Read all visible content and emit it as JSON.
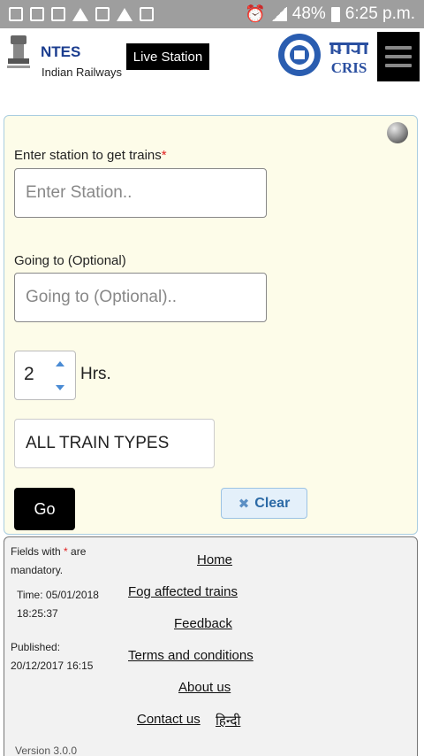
{
  "status_bar": {
    "battery": "48%",
    "time": "6:25 p.m."
  },
  "header": {
    "brand_title": "NTES",
    "brand_subtitle": "Indian Railways",
    "live_station_label": "Live Station",
    "cris_label": "CRIS"
  },
  "form": {
    "station_label": "Enter station to get trains",
    "required_mark": "*",
    "station_placeholder": "Enter Station..",
    "going_label": "Going to (Optional)",
    "going_placeholder": "Going to (Optional)..",
    "hours_value": "2",
    "hours_unit": "Hrs.",
    "train_type_selected": "ALL TRAIN TYPES",
    "go_label": "Go",
    "clear_label": "Clear"
  },
  "footer": {
    "mandatory_prefix": "Fields with",
    "mandatory_mark": "*",
    "mandatory_suffix": "are mandatory.",
    "time_label": "Time: 05/01/2018 18:25:37",
    "published_label": "Published: 20/12/2017 16:15",
    "links": {
      "home": "Home",
      "fog": "Fog affected trains",
      "feedback": "Feedback",
      "terms": "Terms and conditions",
      "about": "About us",
      "contact": "Contact us",
      "hindi": "हिन्दी"
    },
    "version": "Version 3.0.0"
  },
  "colors": {
    "brand_blue": "#1b3d8f",
    "panel_bg": "#fdfce9",
    "clear_text": "#2c6aa6"
  }
}
